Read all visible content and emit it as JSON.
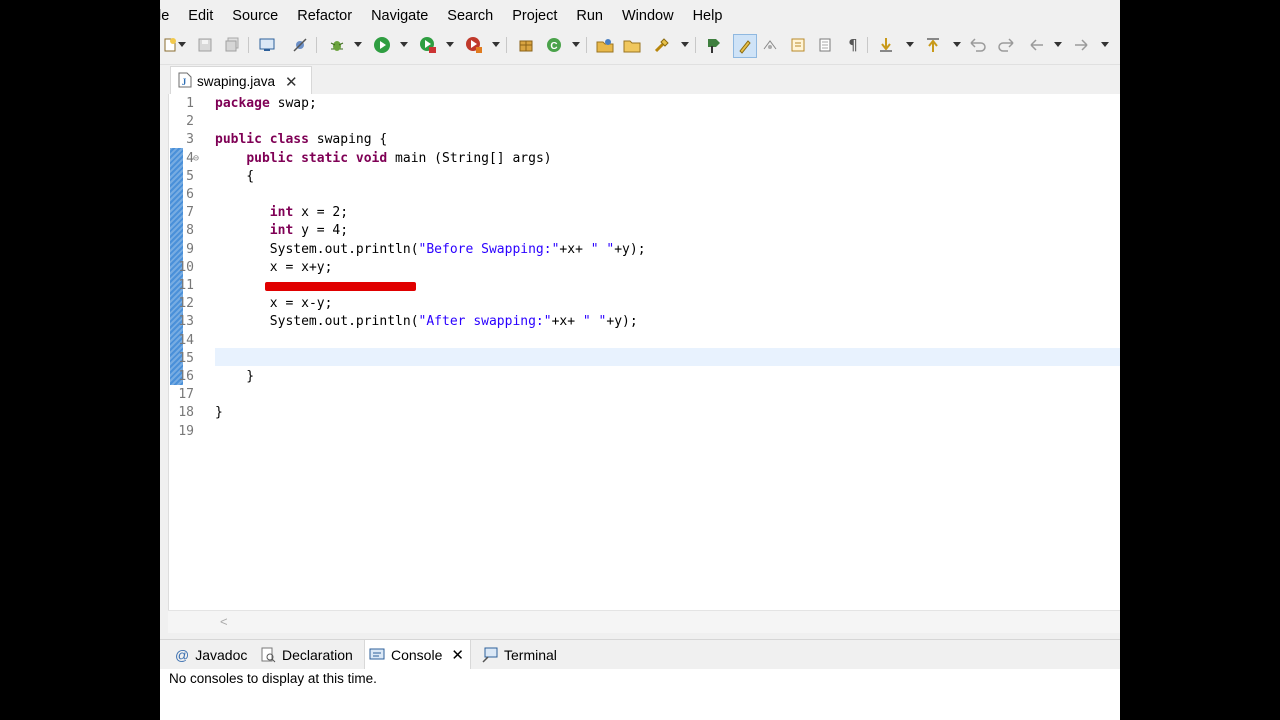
{
  "menu": [
    "le",
    "Edit",
    "Source",
    "Refactor",
    "Navigate",
    "Search",
    "Project",
    "Run",
    "Window",
    "Help"
  ],
  "toolbar_icons": [
    "new-icon",
    "save-icon",
    "save-all-icon",
    "terminal-icon",
    "skip-breakpoints-icon",
    "debug-icon",
    "run-icon",
    "run-coverage-icon",
    "external-tools-icon",
    "new-java-package-icon",
    "new-java-class-icon",
    "open-type-icon",
    "open-task-icon",
    "search-icon",
    "toggle-breadcrumb-icon",
    "mark-occurrences-icon",
    "toggle-block-selection-icon",
    "show-whitespace-icon",
    "next-annotation-icon",
    "previous-annotation-icon",
    "back-icon",
    "forward-icon"
  ],
  "editor_tab": {
    "title": "swaping.java"
  },
  "code_lines": [
    {
      "n": "1",
      "text": "package swap;"
    },
    {
      "n": "2",
      "text": ""
    },
    {
      "n": "3",
      "text": "public class swaping {"
    },
    {
      "n": "4",
      "text": "    public static void main (String[] args)"
    },
    {
      "n": "5",
      "text": "    {"
    },
    {
      "n": "6",
      "text": ""
    },
    {
      "n": "7",
      "text": "       int x = 2;"
    },
    {
      "n": "8",
      "text": "       int y = 4;"
    },
    {
      "n": "9",
      "text": "       System.out.println(\"Before Swapping:\"+x+ \" \"+y);"
    },
    {
      "n": "10",
      "text": "       x = x+y;"
    },
    {
      "n": "11",
      "text": ""
    },
    {
      "n": "12",
      "text": "       x = x-y;"
    },
    {
      "n": "13",
      "text": "       System.out.println(\"After swapping:\"+x+ \" \"+y);"
    },
    {
      "n": "14",
      "text": ""
    },
    {
      "n": "15",
      "text": ""
    },
    {
      "n": "16",
      "text": "    }"
    },
    {
      "n": "17",
      "text": ""
    },
    {
      "n": "18",
      "text": "}"
    },
    {
      "n": "19",
      "text": ""
    }
  ],
  "bottom_tabs": {
    "javadoc": "Javadoc",
    "declaration": "Declaration",
    "console": "Console",
    "terminal": "Terminal"
  },
  "console": {
    "message": "No consoles to display at this time."
  },
  "colors": {
    "keyword": "#7f0055",
    "string": "#2a00ff",
    "line_number": "#787878",
    "annotation": "#e00000",
    "current_line": "#e8f2fe"
  }
}
